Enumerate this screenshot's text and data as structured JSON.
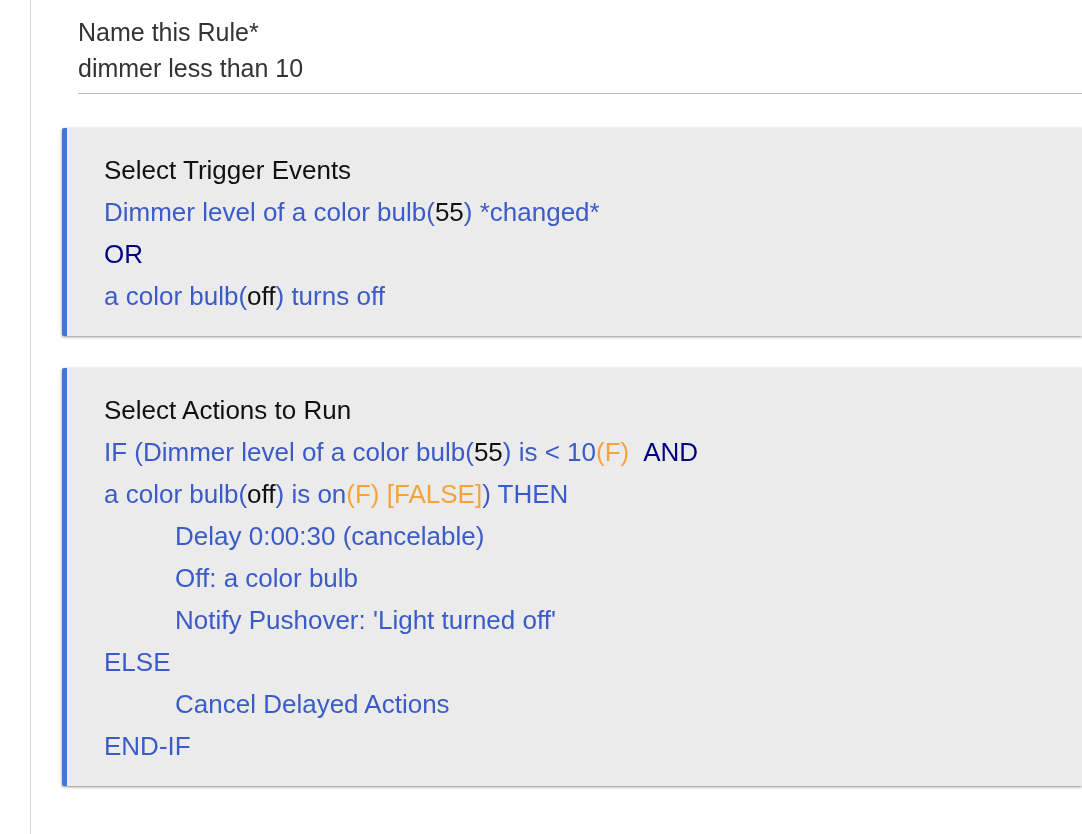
{
  "rule_name": {
    "label": "Name this Rule*",
    "value": "dimmer less than 10"
  },
  "sections": [
    {
      "title": "Select Trigger Events",
      "lines": [
        {
          "segments": [
            {
              "kind": "text",
              "text": "Dimmer level of a color bulb("
            },
            {
              "kind": "value",
              "text": "55"
            },
            {
              "kind": "text",
              "text": ") *changed*"
            }
          ]
        },
        {
          "segments": [
            {
              "kind": "keyword",
              "text": "OR"
            }
          ]
        },
        {
          "segments": [
            {
              "kind": "text",
              "text": "a color bulb("
            },
            {
              "kind": "value",
              "text": "off"
            },
            {
              "kind": "text",
              "text": ") turns off"
            }
          ]
        }
      ]
    },
    {
      "title": "Select Actions to Run",
      "lines": [
        {
          "segments": [
            {
              "kind": "text",
              "text": "IF (Dimmer level of a color bulb("
            },
            {
              "kind": "value",
              "text": "55"
            },
            {
              "kind": "text",
              "text": ") is < 10"
            },
            {
              "kind": "flag",
              "text": "(F)"
            },
            {
              "kind": "keyword",
              "text": "AND"
            }
          ]
        },
        {
          "segments": [
            {
              "kind": "text",
              "text": "a color bulb("
            },
            {
              "kind": "value",
              "text": "off"
            },
            {
              "kind": "text",
              "text": ") is on"
            },
            {
              "kind": "flag",
              "text": "(F) [FALSE]"
            },
            {
              "kind": "text",
              "text": ") THEN"
            }
          ],
          "children": [
            {
              "segments": [
                {
                  "kind": "text",
                  "text": "Delay 0:00:30 (cancelable)"
                }
              ]
            },
            {
              "segments": [
                {
                  "kind": "text",
                  "text": "Off: a color bulb"
                }
              ]
            },
            {
              "segments": [
                {
                  "kind": "text",
                  "text": "Notify Pushover: 'Light turned off'"
                }
              ]
            }
          ]
        },
        {
          "segments": [
            {
              "kind": "text",
              "text": "ELSE"
            }
          ],
          "children": [
            {
              "segments": [
                {
                  "kind": "text",
                  "text": "Cancel Delayed Actions"
                }
              ]
            }
          ]
        },
        {
          "segments": [
            {
              "kind": "text",
              "text": "END-IF"
            }
          ]
        }
      ]
    }
  ]
}
